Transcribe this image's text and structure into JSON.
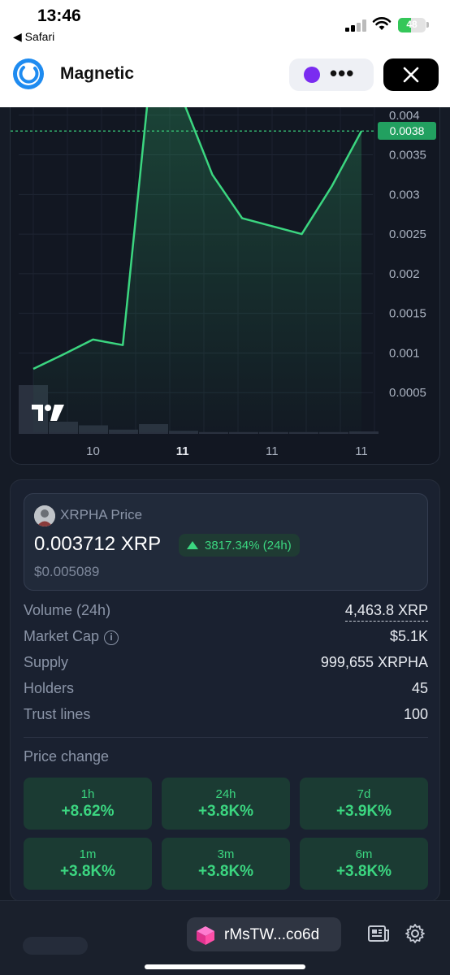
{
  "status_bar": {
    "time": "13:46",
    "back_label": "◀ Safari",
    "battery_level": "48",
    "battery_fraction": 0.48
  },
  "header": {
    "app_name": "Magnetic",
    "more_icon": "•••",
    "close_icon": "close-icon"
  },
  "colors": {
    "accent_green": "#3bd680",
    "price_tag": "#22a060",
    "chart_bg": "#121722",
    "brand_blue": "#1e8bf0"
  },
  "chart_data": {
    "type": "line",
    "x": [
      0,
      1,
      2,
      3,
      4,
      5,
      6,
      7,
      8,
      9,
      10,
      11
    ],
    "values": [
      0.0008,
      0.00098,
      0.00117,
      0.0011,
      0.0048,
      0.0042,
      0.00325,
      0.0027,
      0.0026,
      0.0025,
      0.0031,
      0.0038
    ],
    "volume": [
      0.8,
      0.2,
      0.14,
      0.07,
      0.16,
      0.05,
      0.03,
      0.03,
      0.03,
      0.03,
      0.03,
      0.04
    ],
    "ylim": [
      0,
      0.0041
    ],
    "yticks": [
      "0.004",
      "0.0035",
      "0.003",
      "0.0025",
      "0.002",
      "0.0015",
      "0.001",
      "0.0005"
    ],
    "ytick_values": [
      0.004,
      0.0035,
      0.003,
      0.0025,
      0.002,
      0.0015,
      0.001,
      0.0005
    ],
    "xticks": [
      {
        "label": "10",
        "at": 2.0,
        "bold": false
      },
      {
        "label": "11",
        "at": 5.0,
        "bold": true
      },
      {
        "label": "11",
        "at": 8.0,
        "bold": false
      },
      {
        "label": "11",
        "at": 11.0,
        "bold": false
      }
    ],
    "current_price_label": "0.0038",
    "current_price": 0.0038,
    "grid": true
  },
  "token": {
    "title": "XRPHA Price",
    "price": "0.003712 XRP",
    "change_24h": "3817.34% (24h)",
    "price_usd": "$0.005089"
  },
  "stats": [
    {
      "label": "Volume (24h)",
      "value": "4,463.8 XRP"
    },
    {
      "label": "Market Cap",
      "value": "$5.1K"
    },
    {
      "label": "Supply",
      "value": "999,655 XRPHA"
    },
    {
      "label": "Holders",
      "value": "45"
    },
    {
      "label": "Trust lines",
      "value": "100"
    }
  ],
  "price_change": {
    "title": "Price change",
    "cells": [
      {
        "period": "1h",
        "value": "+8.62%"
      },
      {
        "period": "24h",
        "value": "+3.8K%"
      },
      {
        "period": "7d",
        "value": "+3.9K%"
      },
      {
        "period": "1m",
        "value": "+3.8K%"
      },
      {
        "period": "3m",
        "value": "+3.8K%"
      },
      {
        "period": "6m",
        "value": "+3.8K%"
      }
    ]
  },
  "bottom_bar": {
    "wallet_address": "rMsTW...co6d"
  }
}
